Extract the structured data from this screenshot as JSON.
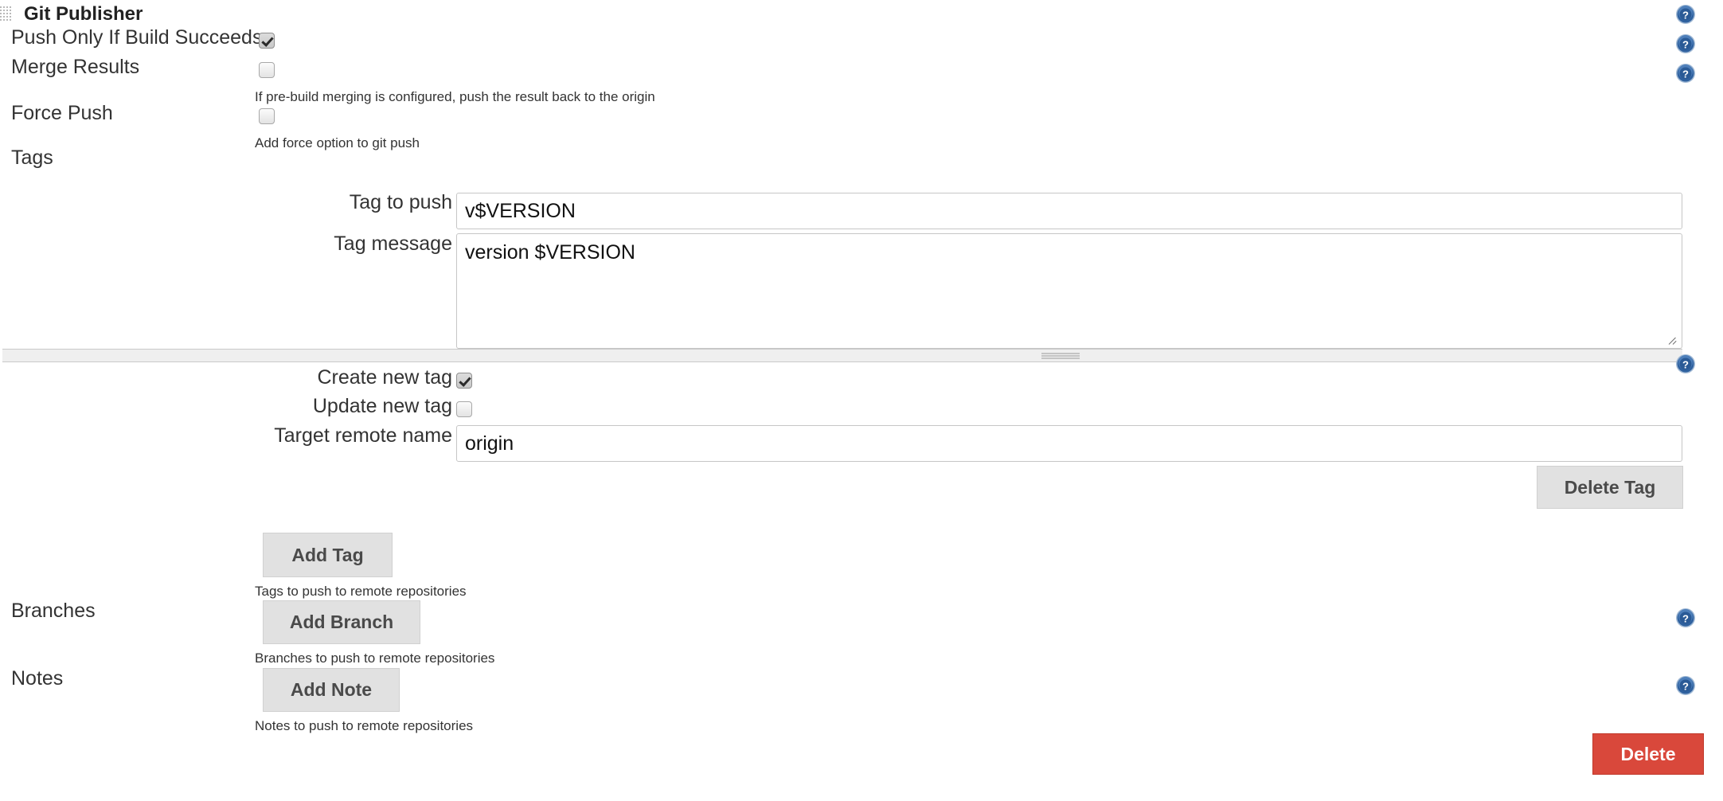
{
  "block": {
    "title": "Git Publisher",
    "drag_handle_icon": "drag-grip-icon"
  },
  "fields": {
    "push_only_if_build_succeeds": {
      "label": "Push Only If Build Succeeds",
      "checked": true
    },
    "merge_results": {
      "label": "Merge Results",
      "checked": false,
      "description": "If pre-build merging is configured, push the result back to the origin"
    },
    "force_push": {
      "label": "Force Push",
      "checked": false,
      "description": "Add force option to git push"
    }
  },
  "tags": {
    "section_label": "Tags",
    "tag_to_push": {
      "label": "Tag to push",
      "value": "v$VERSION"
    },
    "tag_message": {
      "label": "Tag message",
      "value": "version $VERSION"
    },
    "create_new_tag": {
      "label": "Create new tag",
      "checked": true
    },
    "update_new_tag": {
      "label": "Update new tag",
      "checked": false
    },
    "target_remote_name": {
      "label": "Target remote name",
      "value": "origin"
    },
    "delete_tag_button": "Delete Tag",
    "add_tag_button": "Add Tag",
    "description": "Tags to push to remote repositories"
  },
  "branches": {
    "section_label": "Branches",
    "add_branch_button": "Add Branch",
    "description": "Branches to push to remote repositories"
  },
  "notes": {
    "section_label": "Notes",
    "add_note_button": "Add Note",
    "description": "Notes to push to remote repositories"
  },
  "footer": {
    "delete_button": "Delete"
  },
  "help_icons": {
    "label": "Help",
    "count": 6
  },
  "colors": {
    "danger": "#d9483b",
    "button_bg": "#e1e1e1",
    "help_blue": "#2c5f9e",
    "text": "#333333"
  }
}
